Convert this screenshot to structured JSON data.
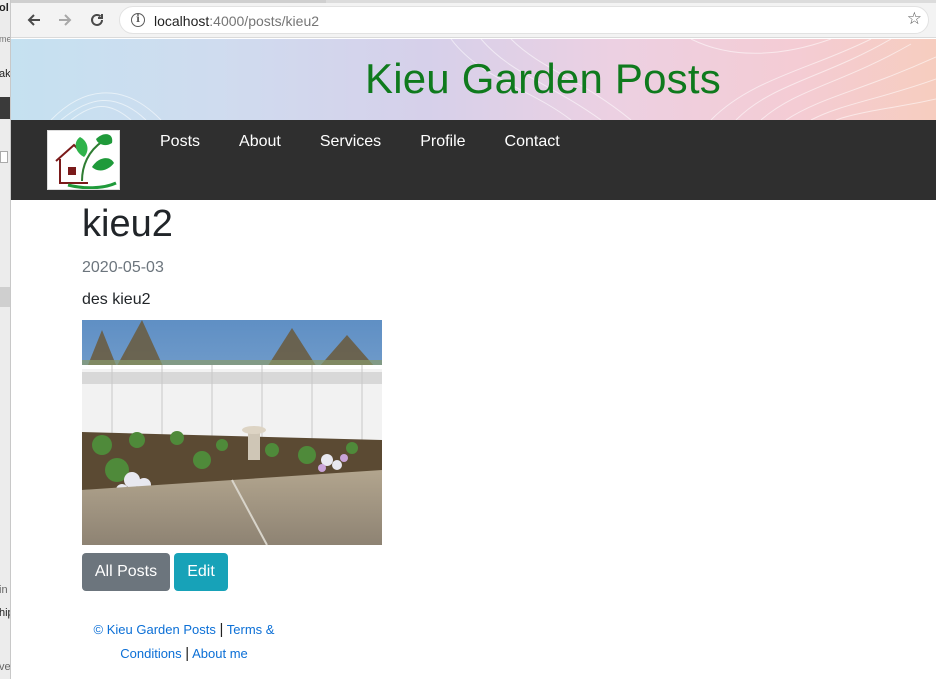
{
  "background_window": {
    "fragments": [
      "ol",
      "me",
      "ak",
      "in",
      "hip",
      "ve"
    ]
  },
  "browser": {
    "url_host": "localhost",
    "url_path": ":4000/posts/kieu2",
    "icons": [
      "back-icon",
      "forward-icon",
      "reload-icon",
      "info-icon",
      "bookmark-star-icon"
    ]
  },
  "header": {
    "title": "Kieu Garden Posts",
    "title_color": "#0f7a1d"
  },
  "navbar": {
    "links": [
      "Posts",
      "About",
      "Services",
      "Profile",
      "Contact"
    ],
    "background": "#2f2f2f"
  },
  "post": {
    "title": "kieu2",
    "date": "2020-05-03",
    "description": "des kieu2"
  },
  "actions": {
    "all_posts_label": "All Posts",
    "edit_label": "Edit"
  },
  "footer": {
    "copyright": "© Kieu Garden Posts",
    "separator": "|",
    "terms": "Terms & Conditions",
    "about": "About me",
    "link_color": "#0b6fd6"
  }
}
